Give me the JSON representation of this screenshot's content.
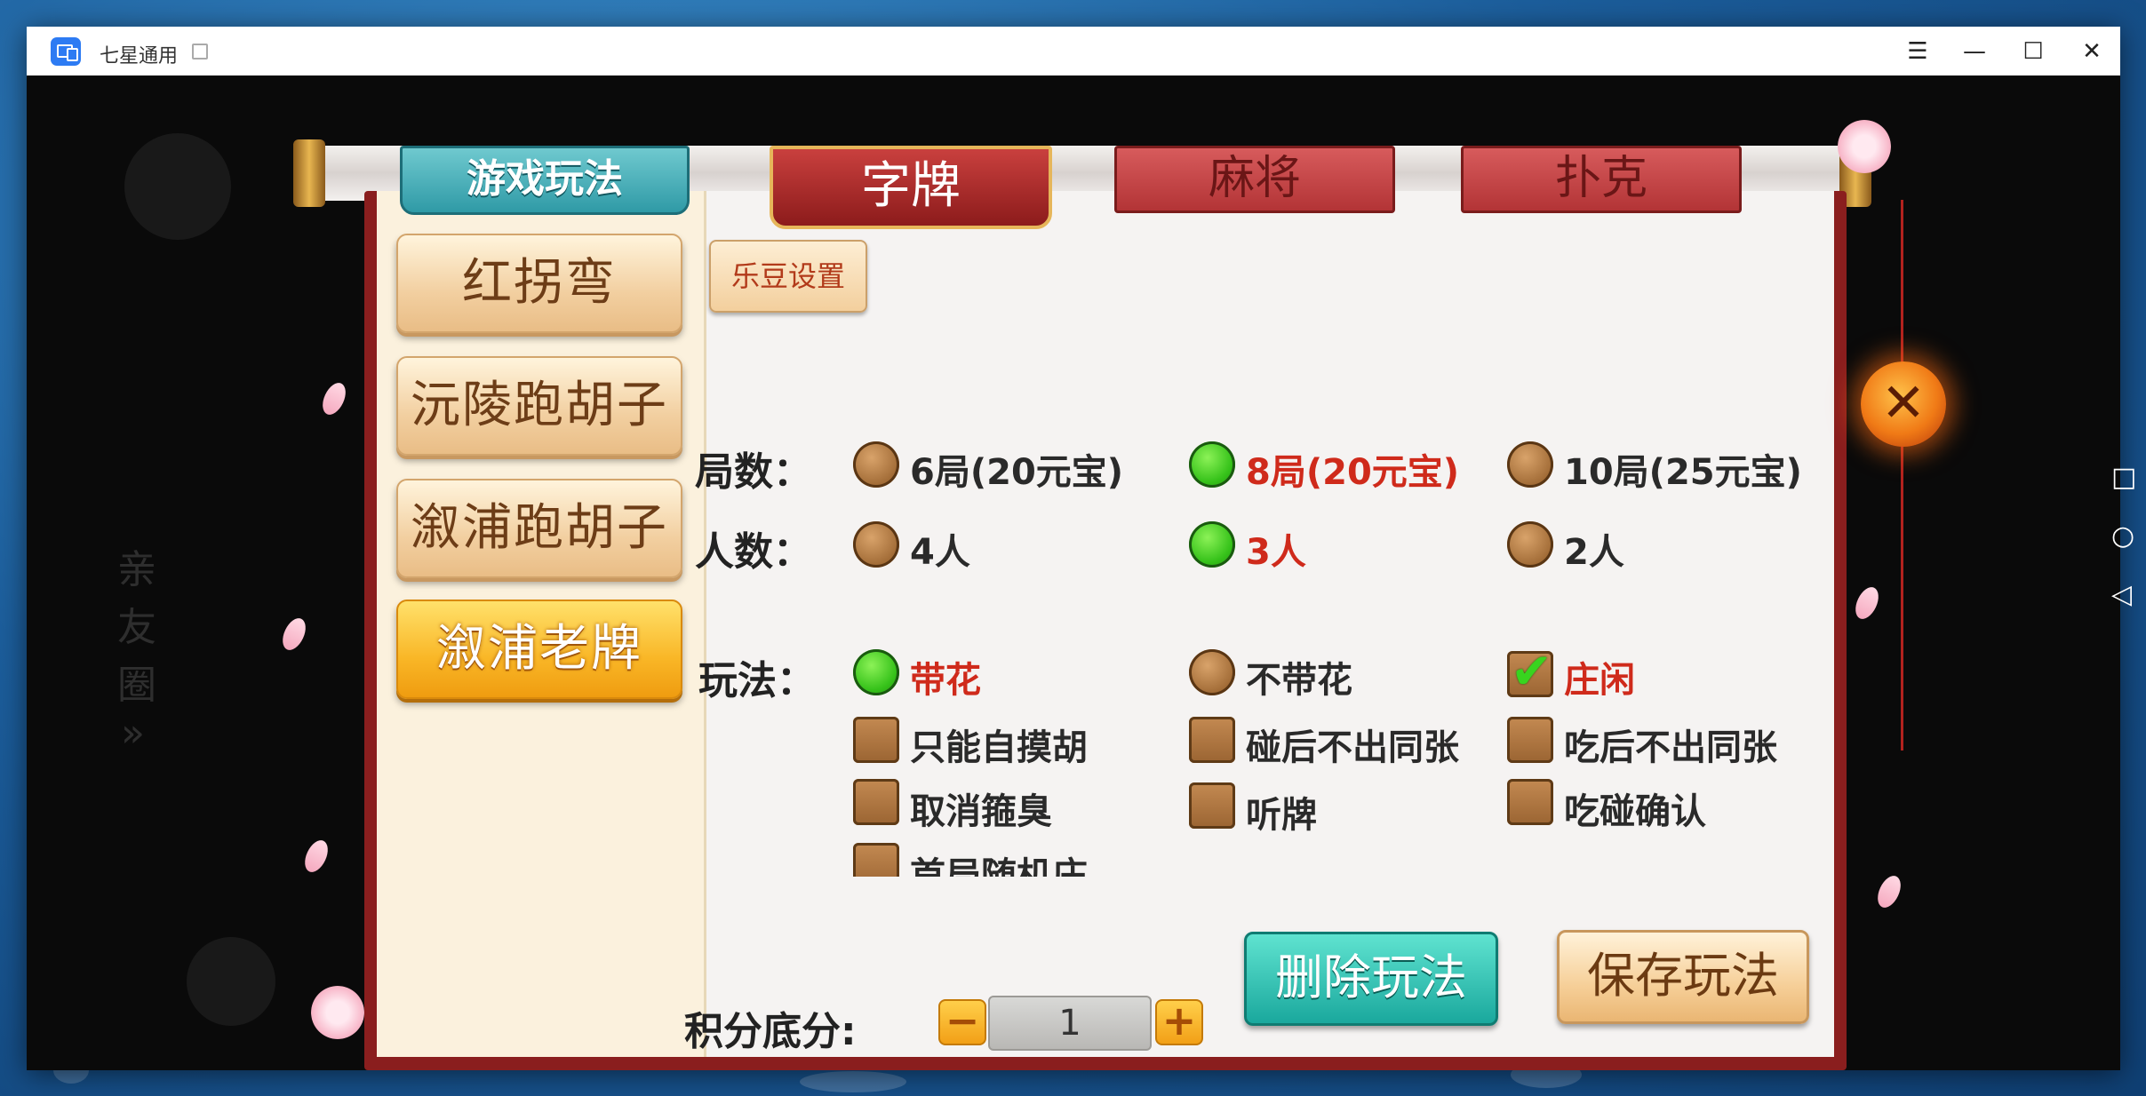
{
  "window": {
    "title": "七星通用",
    "controls": [
      "menu-icon",
      "minimize-icon",
      "maximize-icon",
      "close-icon"
    ]
  },
  "tabs": {
    "rules_label": "游戏玩法",
    "zipai_label": "字牌",
    "majiang_label": "麻将",
    "puke_label": "扑克"
  },
  "sidebar": {
    "items": [
      {
        "label": "红拐弯"
      },
      {
        "label": "沅陵跑胡子"
      },
      {
        "label": "溆浦跑胡子"
      },
      {
        "label": "溆浦老牌",
        "active": true
      }
    ]
  },
  "ledou_label": "乐豆设置",
  "rounds": {
    "label": "局数：",
    "options": [
      {
        "text": "6局(20元宝)",
        "selected": false
      },
      {
        "text": "8局(20元宝)",
        "selected": true
      },
      {
        "text": "10局(25元宝)",
        "selected": false
      }
    ]
  },
  "players": {
    "label": "人数：",
    "options": [
      {
        "text": "4人",
        "selected": false
      },
      {
        "text": "3人",
        "selected": true
      },
      {
        "text": "2人",
        "selected": false
      }
    ]
  },
  "play": {
    "label": "玩法：",
    "radios": [
      {
        "text": "带花",
        "selected": true
      },
      {
        "text": "不带花",
        "selected": false
      }
    ],
    "checks": [
      {
        "text": "庄闲",
        "checked": true
      },
      {
        "text": "只能自摸胡",
        "checked": false
      },
      {
        "text": "碰后不出同张",
        "checked": false
      },
      {
        "text": "吃后不出同张",
        "checked": false
      },
      {
        "text": "取消箍臭",
        "checked": false
      },
      {
        "text": "听牌",
        "checked": false
      },
      {
        "text": "吃碰确认",
        "checked": false
      },
      {
        "text": "首局随机庄",
        "checked": false
      }
    ]
  },
  "score": {
    "label": "积分底分:",
    "value": "1",
    "minus": "−",
    "plus": "+"
  },
  "actions": {
    "delete_label": "删除玩法",
    "save_label": "保存玩法"
  },
  "close_glyph": "✕",
  "background_texts": [
    "亲",
    "友",
    "圈",
    "»"
  ],
  "colors": {
    "selected_text": "#cf2a1b",
    "radio_on": "#36c21a",
    "panel_frame": "#8a1e1e",
    "teal_button": "#1aa89d"
  }
}
